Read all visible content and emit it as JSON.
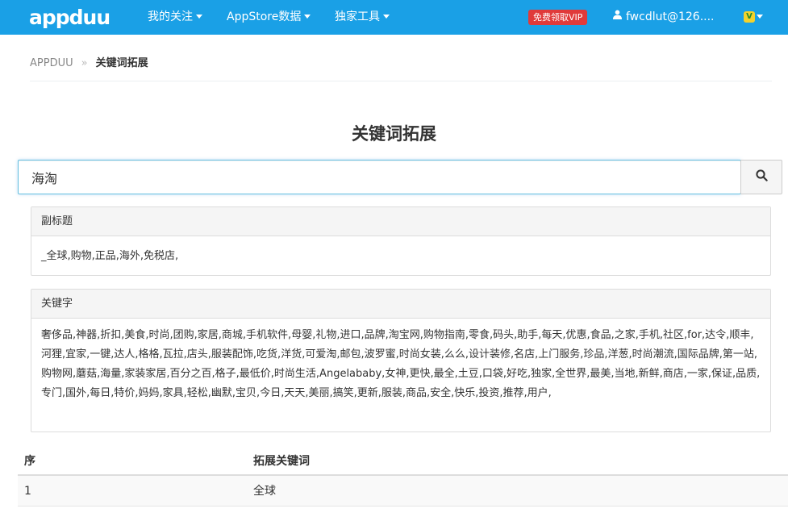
{
  "navbar": {
    "logo": "appduu",
    "menu": [
      {
        "label": "我的关注"
      },
      {
        "label": "AppStore数据"
      },
      {
        "label": "独家工具"
      }
    ],
    "vip_badge": "免费领取VIP",
    "user": "fwcdlut@126....",
    "vip_icon_label": "V",
    "colors": {
      "bar": "#1aa0e6",
      "badge": "#e03a3a",
      "vip_icon": "#f4d22b"
    }
  },
  "breadcrumb": {
    "home": "APPDUU",
    "separator": "»",
    "current": "关键词拓展"
  },
  "page_title": "关键词拓展",
  "search": {
    "value": "海淘",
    "button_icon": "search-icon"
  },
  "subtitle_panel": {
    "heading": "副标题",
    "content": "_全球,购物,正品,海外,免税店,"
  },
  "keywords_panel": {
    "heading": "关键字",
    "content": "奢侈品,神器,折扣,美食,时尚,团购,家居,商城,手机软件,母婴,礼物,进口,品牌,淘宝网,购物指南,零食,码头,助手,每天,优惠,食品,之家,手机,社区,for,达令,顺丰,河狸,宜家,一键,达人,格格,瓦拉,店头,服装配饰,吃货,洋货,可爱淘,邮包,波罗蜜,时尚女装,么么,设计装修,名店,上门服务,珍品,洋葱,时尚潮流,国际品牌,第一站,购物网,蘑菇,海量,家装家居,百分之百,格子,最低价,时尚生活,Angelababy,女神,更快,最全,土豆,口袋,好吃,独家,全世界,最美,当地,新鲜,商店,一家,保证,品质,专门,国外,每日,特价,妈妈,家具,轻松,幽默,宝贝,今日,天天,美丽,搞笑,更新,服装,商品,安全,快乐,投资,推荐,用户,"
  },
  "table": {
    "headers": {
      "seq": "序",
      "keyword": "拓展关键词"
    },
    "rows": [
      {
        "seq": "1",
        "keyword": "全球"
      }
    ]
  }
}
